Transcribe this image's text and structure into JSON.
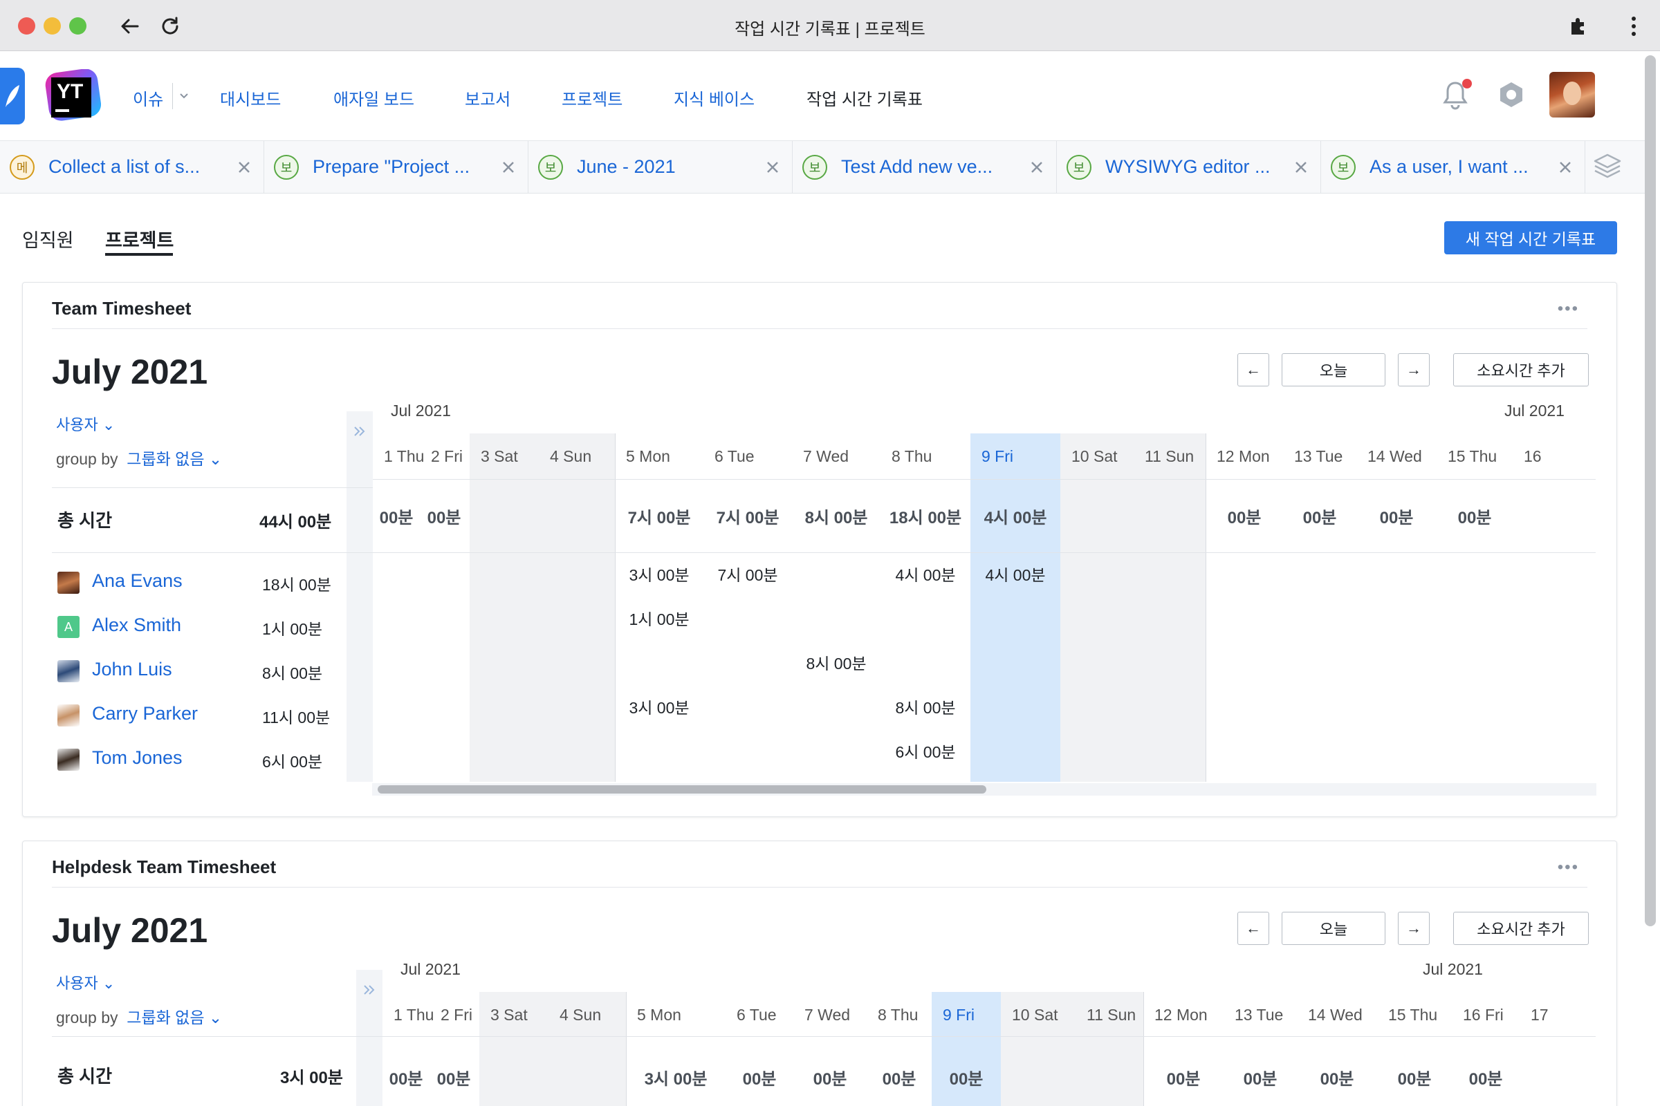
{
  "window": {
    "title": "작업 시간 기록표 | 프로젝트"
  },
  "nav": {
    "logo_text": "YT",
    "items": [
      "이슈",
      "대시보드",
      "애자일 보드",
      "보고서",
      "프로젝트",
      "지식 베이스",
      "작업 시간 기록표"
    ]
  },
  "tabs": [
    {
      "badge": "메",
      "label": "Collect a list of s..."
    },
    {
      "badge": "보",
      "label": "Prepare \"Project ..."
    },
    {
      "badge": "보",
      "label": "June - 2021"
    },
    {
      "badge": "보",
      "label": "Test Add new ve..."
    },
    {
      "badge": "보",
      "label": "WYSIWYG editor ..."
    },
    {
      "badge": "보",
      "label": "As a user, I want ..."
    }
  ],
  "subtabs": [
    "임직원",
    "프로젝트"
  ],
  "new_timesheet_label": "새 작업 시간 기록표",
  "sheet1": {
    "title": "Team Timesheet",
    "menu": "•••",
    "month": "July 2021",
    "today_label": "오늘",
    "prev_label": "←",
    "next_label": "→",
    "add_label": "소요시간 추가",
    "user_label": "사용자",
    "groupby_label": "group by",
    "groupby_value": "그룹화 없음",
    "month_left": "Jul 2021",
    "month_right": "Jul 2021",
    "days": [
      "1 Thu",
      "2 Fri",
      "3 Sat",
      "4 Sun",
      "5 Mon",
      "6 Tue",
      "7 Wed",
      "8 Thu",
      "9 Fri",
      "10 Sat",
      "11 Sun",
      "12 Mon",
      "13 Tue",
      "14 Wed",
      "15 Thu",
      "16"
    ],
    "total_label": "총 시간",
    "total_value": "44시 00분",
    "totals": [
      "00분",
      "00분",
      "",
      "",
      "7시 00분",
      "7시 00분",
      "8시 00분",
      "18시 00분",
      "4시 00분",
      "",
      "",
      "00분",
      "00분",
      "00분",
      "00분",
      ""
    ],
    "users": [
      {
        "name": "Ana Evans",
        "total": "18시 00분",
        "cells": [
          "",
          "",
          "",
          "",
          "3시 00분",
          "7시 00분",
          "",
          "4시 00분",
          "4시 00분",
          "",
          "",
          "",
          "",
          "",
          "",
          ""
        ]
      },
      {
        "name": "Alex Smith",
        "avatar_letter": "A",
        "total": "1시 00분",
        "cells": [
          "",
          "",
          "",
          "",
          "1시 00분",
          "",
          "",
          "",
          "",
          "",
          "",
          "",
          "",
          "",
          "",
          ""
        ]
      },
      {
        "name": "John Luis",
        "total": "8시 00분",
        "cells": [
          "",
          "",
          "",
          "",
          "",
          "",
          "8시 00분",
          "",
          "",
          "",
          "",
          "",
          "",
          "",
          "",
          ""
        ]
      },
      {
        "name": "Carry Parker",
        "total": "11시 00분",
        "cells": [
          "",
          "",
          "",
          "",
          "3시 00분",
          "",
          "",
          "8시 00분",
          "",
          "",
          "",
          "",
          "",
          "",
          "",
          ""
        ]
      },
      {
        "name": "Tom Jones",
        "total": "6시 00분",
        "cells": [
          "",
          "",
          "",
          "",
          "",
          "",
          "",
          "6시 00분",
          "",
          "",
          "",
          "",
          "",
          "",
          "",
          ""
        ]
      }
    ]
  },
  "sheet2": {
    "title": "Helpdesk Team Timesheet",
    "menu": "•••",
    "month": "July 2021",
    "today_label": "오늘",
    "prev_label": "←",
    "next_label": "→",
    "add_label": "소요시간 추가",
    "user_label": "사용자",
    "groupby_label": "group by",
    "groupby_value": "그룹화 없음",
    "month_left": "Jul 2021",
    "month_right": "Jul 2021",
    "days": [
      "1 Thu",
      "2 Fri",
      "3 Sat",
      "4 Sun",
      "5 Mon",
      "6 Tue",
      "7 Wed",
      "8 Thu",
      "9 Fri",
      "10 Sat",
      "11 Sun",
      "12 Mon",
      "13 Tue",
      "14 Wed",
      "15 Thu",
      "16 Fri",
      "17"
    ],
    "total_label": "총 시간",
    "total_value": "3시 00분",
    "totals": [
      "00분",
      "00분",
      "",
      "",
      "3시 00분",
      "00분",
      "00분",
      "00분",
      "00분",
      "",
      "",
      "00분",
      "00분",
      "00분",
      "00분",
      "00분",
      ""
    ]
  },
  "colors": {
    "accent": "#2d7ae6",
    "link": "#1a66d6",
    "today": "#d6e8fb",
    "weekend": "#f1f2f4"
  }
}
